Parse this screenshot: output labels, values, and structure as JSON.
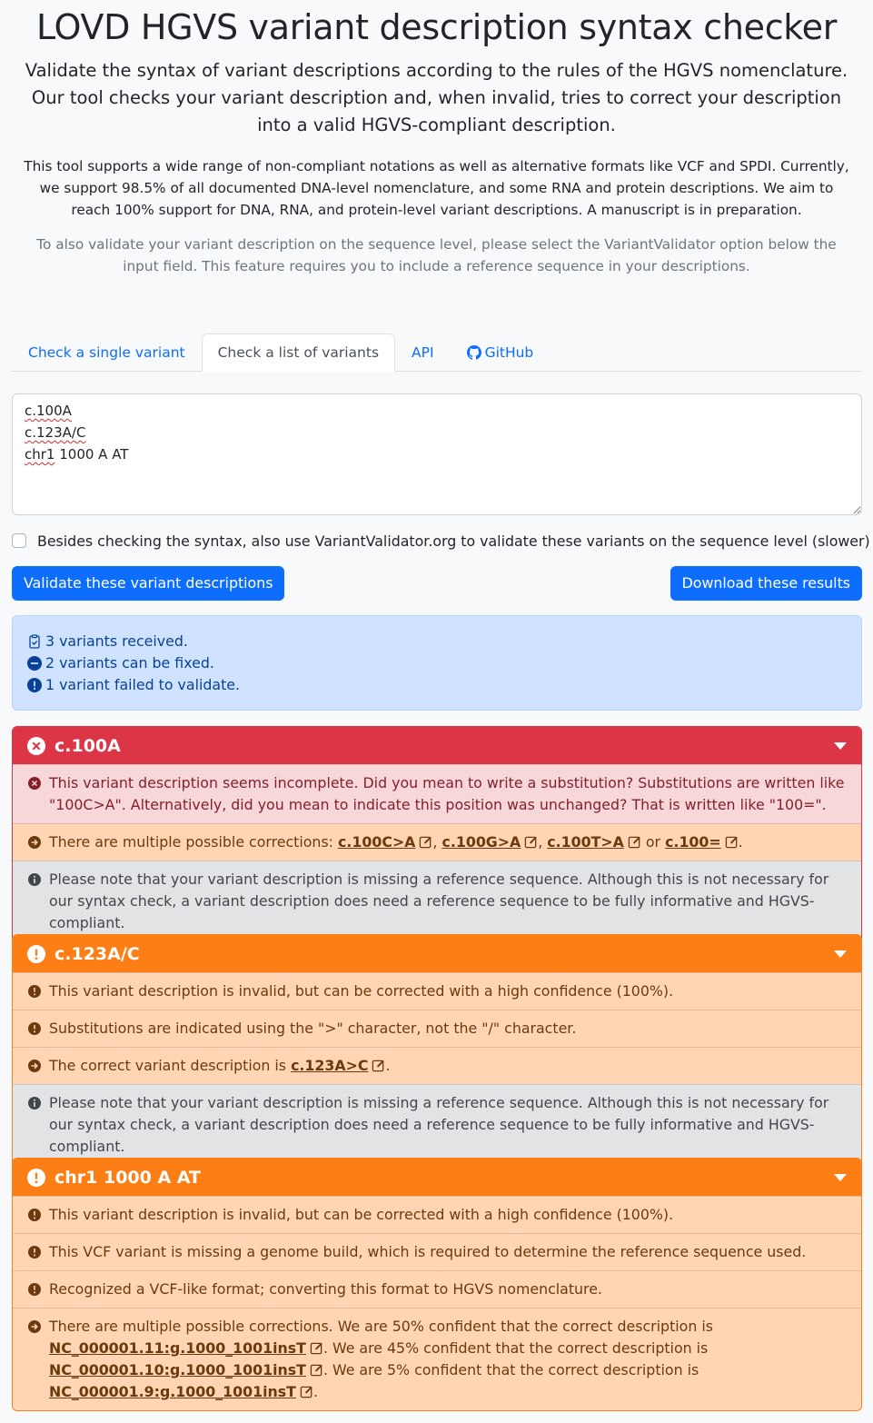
{
  "header": {
    "title": "LOVD HGVS variant description syntax checker",
    "lead": "Validate the syntax of variant descriptions according to the rules of the HGVS nomenclature. Our tool checks your variant description and, when invalid, tries to correct your description into a valid HGVS-compliant description.",
    "para": "This tool supports a wide range of non-compliant notations as well as alternative formats like VCF and SPDI. Currently, we support 98.5% of all documented DNA-level nomenclature, and some RNA and protein descriptions. We aim to reach 100% support for DNA, RNA, and protein-level variant descriptions. A manuscript is in preparation.",
    "muted": "To also validate your variant description on the sequence level, please select the VariantValidator option below the input field. This feature requires you to include a reference sequence in your descriptions."
  },
  "tabs": {
    "single": "Check a single variant",
    "list": "Check a list of variants",
    "api": "API",
    "github": "GitHub"
  },
  "input": {
    "line1": "c.100A",
    "line2": "c.123A/C",
    "line3_a": "chr1",
    "line3_b": " 1000 A AT"
  },
  "options": {
    "vv_label": "Besides checking the syntax, also use VariantValidator.org to validate these variants on the sequence level (slower)"
  },
  "buttons": {
    "validate": "Validate these variant descriptions",
    "download": "Download these results"
  },
  "summary": {
    "received": "3 variants received.",
    "fixable": "2 variants can be fixed.",
    "failed": "1 variant failed to validate."
  },
  "results": {
    "r1": {
      "title": "c.100A",
      "msg1": "This variant description seems incomplete. Did you mean to write a substitution? Substitutions are written like \"100C>A\". Alternatively, did you mean to indicate this position was unchanged? That is written like \"100=\".",
      "corr_prefix": "There are multiple possible corrections: ",
      "c1": "c.100C>A",
      "c2": "c.100G>A",
      "c3": "c.100T>A",
      "c4": "c.100=",
      "sep1": ", ",
      "sep2": ", ",
      "sep3": " or ",
      "end": ".",
      "note": "Please note that your variant description is missing a reference sequence. Although this is not necessary for our syntax check, a variant description does need a reference sequence to be fully informative and HGVS-compliant."
    },
    "r2": {
      "title": "c.123A/C",
      "msg1": "This variant description is invalid, but can be corrected with a high confidence (100%).",
      "msg2": "Substitutions are indicated using the \">\" character, not the \"/\" character.",
      "corr_prefix": "The correct variant description is ",
      "c1": "c.123A>C",
      "end": ".",
      "note": "Please note that your variant description is missing a reference sequence. Although this is not necessary for our syntax check, a variant description does need a reference sequence to be fully informative and HGVS-compliant."
    },
    "r3": {
      "title": "chr1 1000 A AT",
      "msg1": "This variant description is invalid, but can be corrected with a high confidence (100%).",
      "msg2": "This VCF variant is missing a genome build, which is required to determine the reference sequence used.",
      "msg3": "Recognized a VCF-like format; converting this format to HGVS nomenclature.",
      "corr_a": "There are multiple possible corrections. We are 50% confident that the correct description is",
      "c1": "NC_000001.11:g.1000_1001insT",
      "corr_b": ". We are 45% confident that the correct description is",
      "c2": "NC_000001.10:g.1000_1001insT",
      "corr_c": ". We are 5% confident that the correct description is",
      "c3": "NC_000001.9:g.1000_1001insT",
      "end": "."
    }
  },
  "colors": {
    "primary": "#0d6efd",
    "danger": "#dc3545",
    "warning": "#fd7e14",
    "info_bg": "#cfe2ff"
  }
}
